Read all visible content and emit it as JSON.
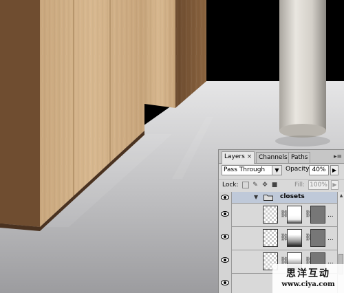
{
  "layers_panel": {
    "tabs": [
      {
        "label": "Layers",
        "active": true,
        "close": "×"
      },
      {
        "label": "Channels",
        "active": false
      },
      {
        "label": "Paths",
        "active": false
      }
    ],
    "panel_menu_icon": "panel-menu-icon",
    "blend_mode": "Pass Through",
    "opacity_label": "Opacity:",
    "opacity_value": "40%",
    "lock_label": "Lock:",
    "fill_label": "Fill:",
    "fill_value": "100%",
    "group": {
      "name": "closets",
      "expanded": true
    },
    "layers": [
      {
        "thumb": "transparent",
        "mask": "white",
        "more": "..."
      },
      {
        "thumb": "transparent",
        "mask": "gradient",
        "more": "..."
      },
      {
        "thumb": "transparent",
        "mask": "gradient",
        "more": "..."
      }
    ]
  },
  "watermark": {
    "title": "思洋互动",
    "url": "www.ciya.com"
  },
  "colors": {
    "floor": "#b7b7b9",
    "wall": "#000000",
    "wood": "#b08a61",
    "pillar": "#d8d5cf",
    "panel_bg": "#d9d9d9",
    "group_row": "#bfc9d9"
  }
}
